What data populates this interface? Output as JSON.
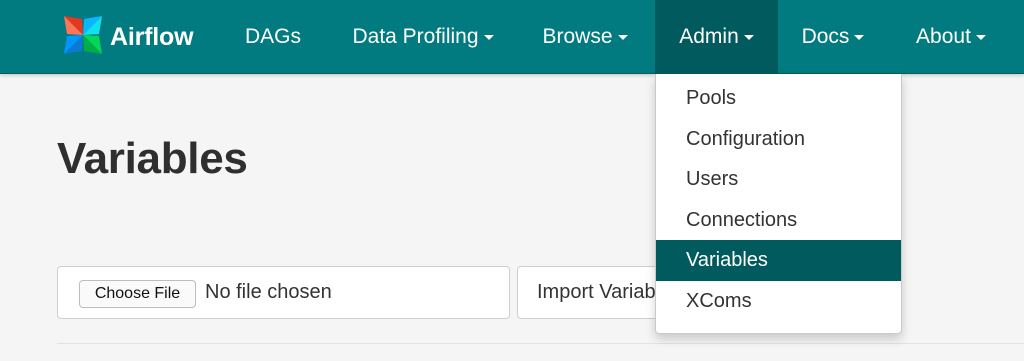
{
  "brand": {
    "name": "Airflow",
    "logo_icon": "pinwheel-logo-icon"
  },
  "nav": {
    "items": [
      {
        "label": "DAGs",
        "dropdown": false
      },
      {
        "label": "Data Profiling",
        "dropdown": true
      },
      {
        "label": "Browse",
        "dropdown": true
      },
      {
        "label": "Admin",
        "dropdown": true,
        "active": true
      },
      {
        "label": "Docs",
        "dropdown": true
      },
      {
        "label": "About",
        "dropdown": true
      }
    ]
  },
  "admin_menu": {
    "items": [
      "Pools",
      "Configuration",
      "Users",
      "Connections",
      "Variables",
      "XComs"
    ],
    "selected": "Variables"
  },
  "page": {
    "title": "Variables",
    "choose_file_label": "Choose File",
    "file_status": "No file chosen",
    "import_label": "Import Variables"
  },
  "colors": {
    "navbar": "#017b7f",
    "active": "#015a5d",
    "background": "#f5f5f5"
  }
}
